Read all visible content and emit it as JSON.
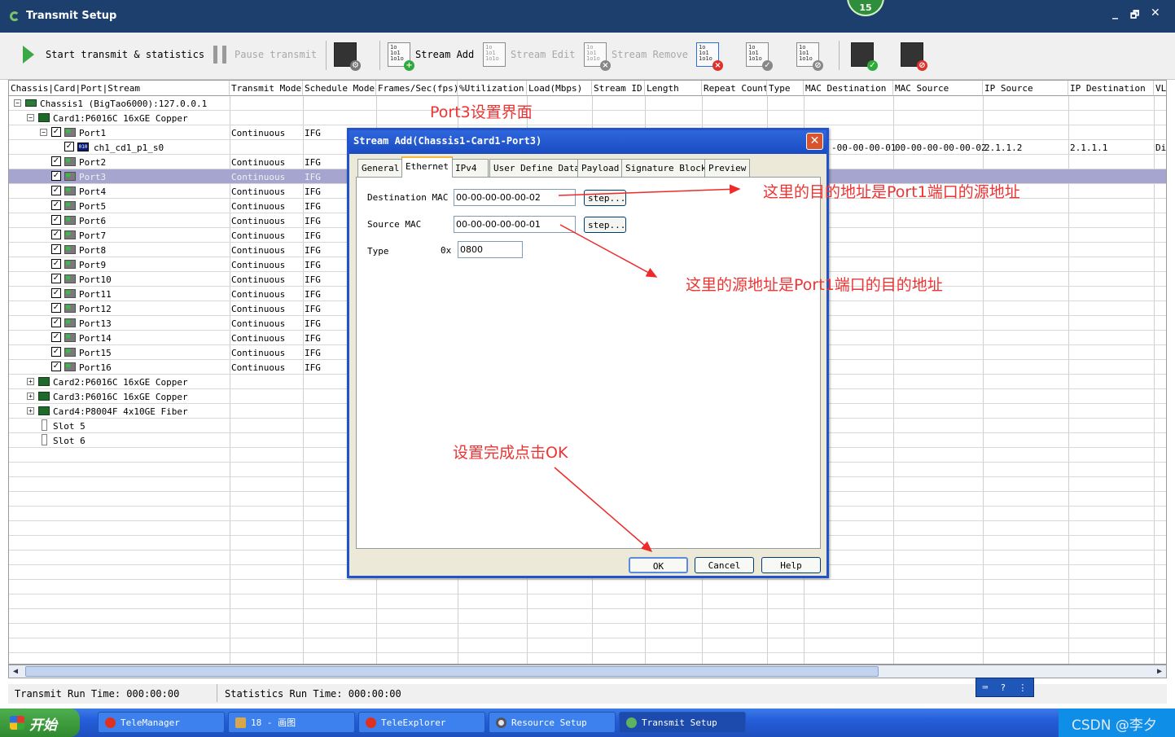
{
  "window": {
    "title": "Transmit Setup",
    "badge": "15",
    "minimize": "_",
    "restore": "🗗",
    "close": "✕"
  },
  "toolbar": {
    "start_label": "Start transmit & statistics",
    "pause_label": "Pause transmit",
    "stream_add_label": "Stream Add",
    "stream_edit_label": "Stream Edit",
    "stream_remove_label": "Stream Remove"
  },
  "columns": [
    "Chassis|Card|Port|Stream",
    "Transmit Mode",
    "Schedule Mode",
    "Frames/Sec(fps)",
    "%Utilization",
    "Load(Mbps)",
    "Stream ID",
    "Length",
    "Repeat Count",
    "Type",
    "MAC Destination",
    "MAC Source",
    "IP Source",
    "IP Destination",
    "VL"
  ],
  "tree": {
    "chassis": "Chassis1 (BigTao6000):127.0.0.1",
    "card1": "Card1:P6016C 16xGE Copper",
    "card2": "Card2:P6016C 16xGE Copper",
    "card3": "Card3:P6016C 16xGE Copper",
    "card4": "Card4:P8004F 4x10GE Fiber",
    "slot5": "Slot 5",
    "slot6": "Slot 6",
    "stream": {
      "name": "ch1_cd1_p1_s0",
      "icon": "010",
      "mac_destination": "-00-00-00-01",
      "mac_source": "00-00-00-00-00-02",
      "ip_source": "2.1.1.2",
      "ip_destination": "2.1.1.1",
      "vlan": "Di"
    },
    "ports": [
      {
        "name": "Port1",
        "mode": "Continuous",
        "schedule": "IFG"
      },
      {
        "name": "Port2",
        "mode": "Continuous",
        "schedule": "IFG"
      },
      {
        "name": "Port3",
        "mode": "Continuous",
        "schedule": "IFG"
      },
      {
        "name": "Port4",
        "mode": "Continuous",
        "schedule": "IFG"
      },
      {
        "name": "Port5",
        "mode": "Continuous",
        "schedule": "IFG"
      },
      {
        "name": "Port6",
        "mode": "Continuous",
        "schedule": "IFG"
      },
      {
        "name": "Port7",
        "mode": "Continuous",
        "schedule": "IFG"
      },
      {
        "name": "Port8",
        "mode": "Continuous",
        "schedule": "IFG"
      },
      {
        "name": "Port9",
        "mode": "Continuous",
        "schedule": "IFG"
      },
      {
        "name": "Port10",
        "mode": "Continuous",
        "schedule": "IFG"
      },
      {
        "name": "Port11",
        "mode": "Continuous",
        "schedule": "IFG"
      },
      {
        "name": "Port12",
        "mode": "Continuous",
        "schedule": "IFG"
      },
      {
        "name": "Port13",
        "mode": "Continuous",
        "schedule": "IFG"
      },
      {
        "name": "Port14",
        "mode": "Continuous",
        "schedule": "IFG"
      },
      {
        "name": "Port15",
        "mode": "Continuous",
        "schedule": "IFG"
      },
      {
        "name": "Port16",
        "mode": "Continuous",
        "schedule": "IFG"
      }
    ]
  },
  "status": {
    "transmit_run_time": "Transmit Run Time: 000:00:00",
    "statistics_run_time": "Statistics Run Time: 000:00:00"
  },
  "dialog": {
    "title": "Stream Add(Chassis1-Card1-Port3)",
    "tabs": [
      "General",
      "Ethernet",
      "IPv4",
      "User Define Data",
      "Payload",
      "Signature Block",
      "Preview"
    ],
    "active_tab": "Ethernet",
    "dest_mac_label": "Destination MAC",
    "dest_mac_value": "00-00-00-00-00-02",
    "source_mac_label": "Source MAC",
    "source_mac_value": "00-00-00-00-00-01",
    "type_label": "Type",
    "type_prefix": "0x",
    "type_value": "0800",
    "step_label": "step...",
    "ok_label": "OK",
    "cancel_label": "Cancel",
    "help_label": "Help"
  },
  "annotations": {
    "port3_title": "Port3设置界面",
    "dest_note": "这里的目的地址是Port1端口的源地址",
    "source_note": "这里的源地址是Port1端口的目的地址",
    "ok_note": "设置完成点击OK"
  },
  "taskbar": {
    "start": "开始",
    "tasks": [
      "TeleManager",
      "18 - 画图",
      "TeleExplorer",
      "Resource Setup",
      "Transmit Setup"
    ],
    "tray": "CSDN @李夕"
  },
  "colors": {
    "titlebar": "#1c3f6e",
    "selection": "#a5a5cf",
    "annotation": "#ee3333",
    "dialog_title": "#2353c9"
  }
}
